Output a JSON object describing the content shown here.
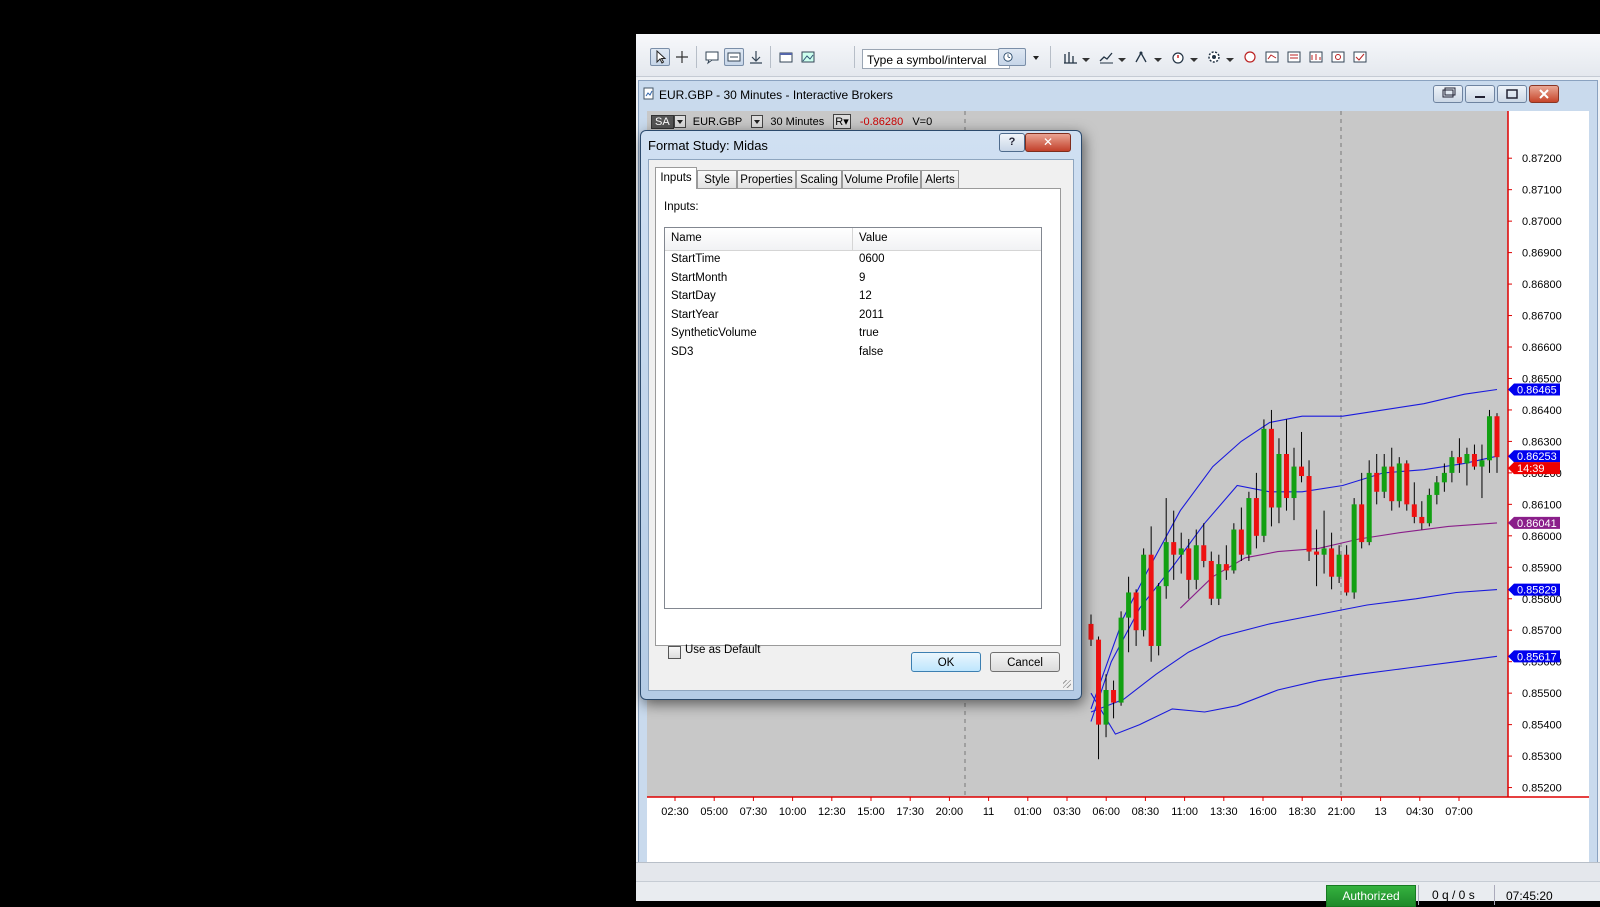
{
  "toolbar": {
    "symbol_placeholder": "Type a symbol/interval"
  },
  "chart_window": {
    "title": "EUR.GBP - 30 Minutes - Interactive Brokers",
    "info": {
      "badge": "SA",
      "symbol": "EUR.GBP",
      "interval": "30 Minutes",
      "range": "R",
      "change": "-0.86280",
      "volume": "V=0"
    }
  },
  "chart_data": {
    "type": "candlestick",
    "y_ticks": [
      "0.87200",
      "0.87100",
      "0.87000",
      "0.86900",
      "0.86800",
      "0.86700",
      "0.86600",
      "0.86500",
      "0.86400",
      "0.86300",
      "0.86200",
      "0.86100",
      "0.86000",
      "0.85900",
      "0.85800",
      "0.85700",
      "0.85600",
      "0.85500",
      "0.85400",
      "0.85300",
      "0.85200"
    ],
    "ylim": [
      0.8517,
      0.8735
    ],
    "x_ticks": [
      "02:30",
      "05:00",
      "07:30",
      "10:00",
      "12:30",
      "15:00",
      "17:30",
      "20:00",
      "11",
      "01:00",
      "03:30",
      "06:00",
      "08:30",
      "11:00",
      "13:30",
      "16:00",
      "18:30",
      "21:00",
      "13",
      "04:30",
      "07:00"
    ],
    "price_flags": [
      {
        "label": "0.86465",
        "value": 0.86465,
        "color": "#0000ee"
      },
      {
        "label": "0.86253",
        "value": 0.86253,
        "color": "#0000ee"
      },
      {
        "label": "14:39",
        "value": 0.86215,
        "color": "#ee0000"
      },
      {
        "label": "0.86041",
        "value": 0.86041,
        "color": "#8a1e8a"
      },
      {
        "label": "0.85829",
        "value": 0.85829,
        "color": "#0000ee"
      },
      {
        "label": "0.85617",
        "value": 0.85617,
        "color": "#0000ee"
      }
    ],
    "candles": [
      [
        0.8572,
        0.8575,
        0.8565,
        0.8567
      ],
      [
        0.8567,
        0.8568,
        0.8529,
        0.854
      ],
      [
        0.854,
        0.8556,
        0.8536,
        0.8551
      ],
      [
        0.8551,
        0.8554,
        0.8542,
        0.8547
      ],
      [
        0.8547,
        0.8576,
        0.8546,
        0.8574
      ],
      [
        0.8574,
        0.8587,
        0.8563,
        0.8582
      ],
      [
        0.8582,
        0.8583,
        0.8565,
        0.857
      ],
      [
        0.857,
        0.8596,
        0.8568,
        0.8594
      ],
      [
        0.8594,
        0.8603,
        0.856,
        0.8565
      ],
      [
        0.8565,
        0.8585,
        0.8562,
        0.8584
      ],
      [
        0.8584,
        0.8612,
        0.858,
        0.8598
      ],
      [
        0.8598,
        0.8608,
        0.8586,
        0.8594
      ],
      [
        0.8594,
        0.8601,
        0.8588,
        0.8596
      ],
      [
        0.8596,
        0.8599,
        0.858,
        0.8586
      ],
      [
        0.8586,
        0.8602,
        0.8583,
        0.8597
      ],
      [
        0.8597,
        0.8604,
        0.859,
        0.8592
      ],
      [
        0.8592,
        0.8595,
        0.8578,
        0.858
      ],
      [
        0.858,
        0.8594,
        0.8578,
        0.8591
      ],
      [
        0.8591,
        0.8597,
        0.8586,
        0.8589
      ],
      [
        0.8589,
        0.8604,
        0.8588,
        0.8602
      ],
      [
        0.8602,
        0.8609,
        0.8592,
        0.8594
      ],
      [
        0.8594,
        0.8614,
        0.8592,
        0.8612
      ],
      [
        0.8612,
        0.862,
        0.8596,
        0.86
      ],
      [
        0.86,
        0.8637,
        0.8598,
        0.8634
      ],
      [
        0.8634,
        0.864,
        0.8603,
        0.8609
      ],
      [
        0.8609,
        0.8631,
        0.8604,
        0.8626
      ],
      [
        0.8626,
        0.8637,
        0.8608,
        0.8612
      ],
      [
        0.8612,
        0.8628,
        0.8605,
        0.8622
      ],
      [
        0.8622,
        0.8633,
        0.8617,
        0.8619
      ],
      [
        0.8619,
        0.8624,
        0.8592,
        0.8595
      ],
      [
        0.8595,
        0.8602,
        0.8584,
        0.8594
      ],
      [
        0.8594,
        0.8608,
        0.8588,
        0.8596
      ],
      [
        0.8596,
        0.8601,
        0.8583,
        0.8587
      ],
      [
        0.8587,
        0.8597,
        0.8585,
        0.8594
      ],
      [
        0.8594,
        0.8597,
        0.8581,
        0.8582
      ],
      [
        0.8582,
        0.8612,
        0.858,
        0.861
      ],
      [
        0.861,
        0.862,
        0.8596,
        0.8598
      ],
      [
        0.8598,
        0.8624,
        0.8597,
        0.862
      ],
      [
        0.862,
        0.8626,
        0.861,
        0.8614
      ],
      [
        0.8614,
        0.8626,
        0.8612,
        0.8622
      ],
      [
        0.8622,
        0.8628,
        0.8608,
        0.8611
      ],
      [
        0.8611,
        0.8625,
        0.8609,
        0.8623
      ],
      [
        0.8623,
        0.8624,
        0.8608,
        0.861
      ],
      [
        0.861,
        0.8617,
        0.8604,
        0.8606
      ],
      [
        0.8606,
        0.8611,
        0.8602,
        0.8604
      ],
      [
        0.8604,
        0.8615,
        0.8603,
        0.8613
      ],
      [
        0.8613,
        0.8619,
        0.861,
        0.8617
      ],
      [
        0.8617,
        0.8623,
        0.8614,
        0.862
      ],
      [
        0.862,
        0.8627,
        0.8617,
        0.8625
      ],
      [
        0.8625,
        0.8631,
        0.862,
        0.8623
      ],
      [
        0.8623,
        0.8628,
        0.8616,
        0.8626
      ],
      [
        0.8626,
        0.8629,
        0.8621,
        0.8622
      ],
      [
        0.8622,
        0.8629,
        0.8612,
        0.8624
      ],
      [
        0.8624,
        0.864,
        0.862,
        0.8638
      ],
      [
        0.8638,
        0.8639,
        0.862,
        0.8625
      ]
    ],
    "series": [
      {
        "color": "#1a1add",
        "values": [
          [
            0,
            0.8545
          ],
          [
            0.03,
            0.8556
          ],
          [
            0.08,
            0.8574
          ],
          [
            0.14,
            0.8589
          ],
          [
            0.22,
            0.8608
          ],
          [
            0.3,
            0.8622
          ],
          [
            0.37,
            0.863
          ],
          [
            0.44,
            0.8636
          ],
          [
            0.52,
            0.8638
          ],
          [
            0.62,
            0.8638
          ],
          [
            0.72,
            0.864
          ],
          [
            0.82,
            0.8642
          ],
          [
            0.92,
            0.8645
          ],
          [
            1,
            0.86465
          ]
        ]
      },
      {
        "color": "#1a1add",
        "values": [
          [
            0,
            0.8541
          ],
          [
            0.05,
            0.856
          ],
          [
            0.12,
            0.8577
          ],
          [
            0.2,
            0.859
          ],
          [
            0.28,
            0.8604
          ],
          [
            0.36,
            0.8616
          ],
          [
            0.44,
            0.8614
          ],
          [
            0.52,
            0.8614
          ],
          [
            0.62,
            0.8616
          ],
          [
            0.72,
            0.862
          ],
          [
            0.82,
            0.8621
          ],
          [
            0.92,
            0.8623
          ],
          [
            1,
            0.86253
          ]
        ]
      },
      {
        "color": "#8a1e8a",
        "values": [
          [
            0.22,
            0.8577
          ],
          [
            0.3,
            0.8587
          ],
          [
            0.38,
            0.8593
          ],
          [
            0.46,
            0.8595
          ],
          [
            0.56,
            0.8596
          ],
          [
            0.66,
            0.8599
          ],
          [
            0.76,
            0.8601
          ],
          [
            0.88,
            0.8603
          ],
          [
            1,
            0.86041
          ]
        ]
      },
      {
        "color": "#1a1add",
        "values": [
          [
            0,
            0.8544
          ],
          [
            0.08,
            0.8548
          ],
          [
            0.16,
            0.8556
          ],
          [
            0.24,
            0.8563
          ],
          [
            0.32,
            0.8568
          ],
          [
            0.44,
            0.8572
          ],
          [
            0.56,
            0.8575
          ],
          [
            0.68,
            0.8578
          ],
          [
            0.8,
            0.858
          ],
          [
            0.9,
            0.8582
          ],
          [
            1,
            0.85829
          ]
        ]
      },
      {
        "color": "#1a1add",
        "values": [
          [
            0,
            0.855
          ],
          [
            0.06,
            0.8537
          ],
          [
            0.12,
            0.854
          ],
          [
            0.2,
            0.8545
          ],
          [
            0.28,
            0.8544
          ],
          [
            0.36,
            0.8546
          ],
          [
            0.46,
            0.8551
          ],
          [
            0.56,
            0.8554
          ],
          [
            0.66,
            0.8556
          ],
          [
            0.78,
            0.8558
          ],
          [
            0.9,
            0.856
          ],
          [
            1,
            0.85617
          ]
        ]
      }
    ]
  },
  "dialog": {
    "title": "Format Study: Midas",
    "help": "?",
    "close": "✕",
    "tabs": [
      "Inputs",
      "Style",
      "Properties",
      "Scaling",
      "Volume Profile",
      "Alerts"
    ],
    "inputs_label": "Inputs:",
    "grid": {
      "headers": [
        "Name",
        "Value"
      ],
      "rows": [
        {
          "name": "StartTime",
          "value": "0600"
        },
        {
          "name": "StartMonth",
          "value": "9"
        },
        {
          "name": "StartDay",
          "value": "12"
        },
        {
          "name": "StartYear",
          "value": "2011"
        },
        {
          "name": "SyntheticVolume",
          "value": "true"
        },
        {
          "name": "SD3",
          "value": "false"
        }
      ]
    },
    "use_default": "Use as Default",
    "ok": "OK",
    "cancel": "Cancel"
  },
  "status": {
    "authorized": "Authorized",
    "quotes": "0 q / 0 s",
    "clock": "07:45:20"
  }
}
